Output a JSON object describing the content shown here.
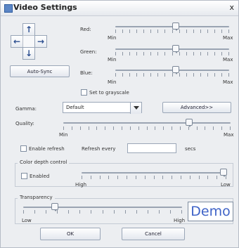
{
  "window": {
    "title": "Video Settings",
    "close_glyph": "x"
  },
  "rgb": {
    "red_label": "Red:",
    "green_label": "Green:",
    "blue_label": "Blue:",
    "min": "Min",
    "max": "Max",
    "red_value": 0.53,
    "green_value": 0.53,
    "blue_value": 0.53
  },
  "position": {
    "up": "↑",
    "left": "←",
    "right": "→",
    "down": "↓"
  },
  "buttons": {
    "auto_sync": "Auto-Sync",
    "advanced": "Advanced>>",
    "ok": "OK",
    "cancel": "Cancel"
  },
  "grayscale": {
    "label": "Set to grayscale",
    "checked": false
  },
  "gamma": {
    "label": "Gamma:",
    "value": "Default"
  },
  "quality": {
    "label": "Quality:",
    "min": "Min",
    "max": "Max",
    "value": 0.75
  },
  "refresh": {
    "enable_label": "Enable refresh",
    "every_label": "Refresh every",
    "value": "",
    "secs": "secs",
    "checked": false
  },
  "color_depth": {
    "group_title": "Color depth control",
    "enabled_label": "Enabled",
    "enabled_checked": false,
    "high": "High",
    "low": "Low",
    "value": 0.98
  },
  "transparency": {
    "group_title": "Transparency",
    "low": "Low",
    "high": "High",
    "value": 0.2,
    "demo": "Demo"
  }
}
